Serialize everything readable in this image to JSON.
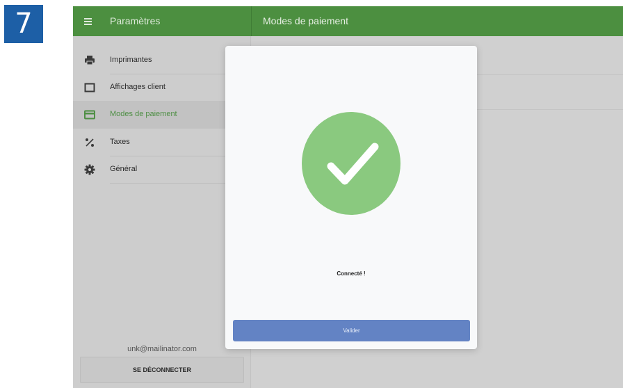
{
  "step_number": "7",
  "topbar": {
    "title_left": "Paramètres",
    "title_right": "Modes de paiement",
    "color": "#4c8f40"
  },
  "sidebar": {
    "items": [
      {
        "label": "Imprimantes",
        "icon": "printer-icon"
      },
      {
        "label": "Affichages client",
        "icon": "display-icon"
      },
      {
        "label": "Modes de paiement",
        "icon": "credit-card-icon",
        "active": true
      },
      {
        "label": "Taxes",
        "icon": "percent-icon"
      },
      {
        "label": "Général",
        "icon": "gear-icon"
      }
    ],
    "user_email": "unk@mailinator.com",
    "logout_label": "SE DÉCONNECTER"
  },
  "modal": {
    "icon": "check-icon",
    "message": "Connecté !",
    "validate_label": "Valider",
    "success_color": "#8ac97f",
    "button_color": "#6383c4"
  }
}
